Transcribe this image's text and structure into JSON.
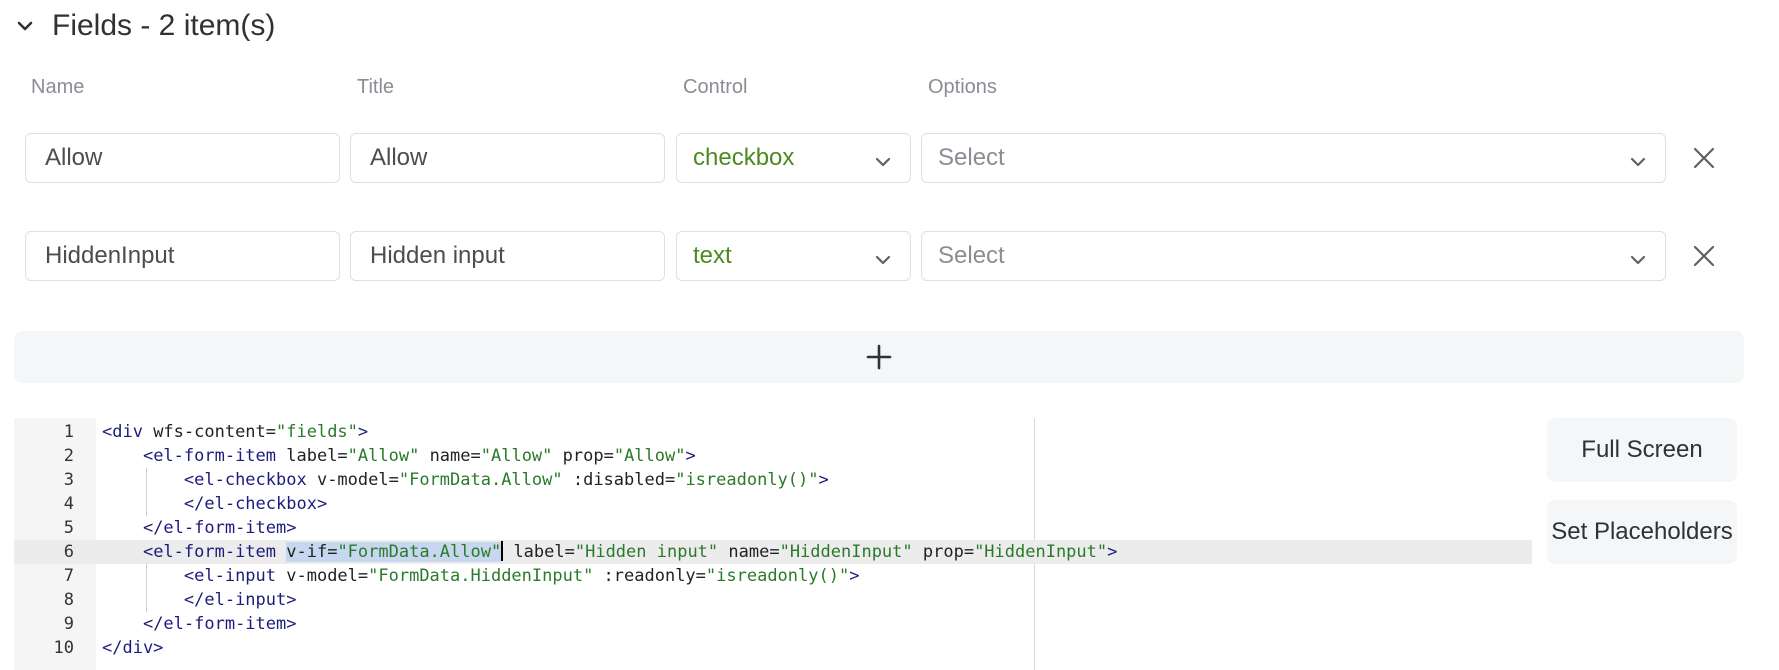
{
  "section": {
    "title": "Fields - 2 item(s)"
  },
  "columns": {
    "name": "Name",
    "title": "Title",
    "control": "Control",
    "options": "Options"
  },
  "rows": [
    {
      "name": "Allow",
      "title": "Allow",
      "control": "checkbox",
      "options_placeholder": "Select"
    },
    {
      "name": "HiddenInput",
      "title": "Hidden input",
      "control": "text",
      "options_placeholder": "Select"
    }
  ],
  "code_lines": [
    {
      "n": "1",
      "indent": "",
      "parts": [
        [
          "t",
          "<div "
        ],
        [
          "a",
          "wfs-content="
        ],
        [
          "s",
          "\"fields\""
        ],
        [
          "t",
          ">"
        ]
      ]
    },
    {
      "n": "2",
      "indent": "    ",
      "parts": [
        [
          "t",
          "<el-form-item "
        ],
        [
          "a",
          "label="
        ],
        [
          "s",
          "\"Allow\""
        ],
        [
          "a",
          " name="
        ],
        [
          "s",
          "\"Allow\""
        ],
        [
          "a",
          " prop="
        ],
        [
          "s",
          "\"Allow\""
        ],
        [
          "t",
          ">"
        ]
      ]
    },
    {
      "n": "3",
      "indent": "        ",
      "parts": [
        [
          "t",
          "<el-checkbox "
        ],
        [
          "a",
          "v-model="
        ],
        [
          "s",
          "\"FormData.Allow\""
        ],
        [
          "a",
          " :disabled="
        ],
        [
          "s",
          "\"isreadonly()\""
        ],
        [
          "t",
          ">"
        ]
      ]
    },
    {
      "n": "4",
      "indent": "        ",
      "parts": [
        [
          "t",
          "</el-checkbox>"
        ]
      ]
    },
    {
      "n": "5",
      "indent": "    ",
      "parts": [
        [
          "t",
          "</el-form-item>"
        ]
      ]
    },
    {
      "n": "6",
      "indent": "    ",
      "parts": [
        [
          "t",
          "<el-form-item "
        ],
        [
          "ah",
          "v-if="
        ],
        [
          "sh",
          "\"FormData.Allow\""
        ],
        [
          "cursor",
          ""
        ],
        [
          "a",
          " label="
        ],
        [
          "s",
          "\"Hidden input\""
        ],
        [
          "a",
          " name="
        ],
        [
          "s",
          "\"HiddenInput\""
        ],
        [
          "a",
          " prop="
        ],
        [
          "s",
          "\"HiddenInput\""
        ],
        [
          "t",
          ">"
        ]
      ]
    },
    {
      "n": "7",
      "indent": "        ",
      "parts": [
        [
          "t",
          "<el-input "
        ],
        [
          "a",
          "v-model="
        ],
        [
          "s",
          "\"FormData.HiddenInput\""
        ],
        [
          "a",
          " :readonly="
        ],
        [
          "s",
          "\"isreadonly()\""
        ],
        [
          "t",
          ">"
        ]
      ]
    },
    {
      "n": "8",
      "indent": "        ",
      "parts": [
        [
          "t",
          "</el-input>"
        ]
      ]
    },
    {
      "n": "9",
      "indent": "    ",
      "parts": [
        [
          "t",
          "</el-form-item>"
        ]
      ]
    },
    {
      "n": "10",
      "indent": "",
      "parts": [
        [
          "t",
          "</div>"
        ]
      ]
    }
  ],
  "active_line": "6",
  "buttons": {
    "full_screen": "Full Screen",
    "set_placeholders": "Set Placeholders"
  },
  "icons": {
    "collapse": "chevron-down-icon",
    "dropdown": "chevron-down-icon",
    "delete": "close-icon",
    "add": "plus-icon"
  },
  "colors": {
    "control_value": "#4e8a1f",
    "placeholder": "#8a8d93",
    "border": "#dcdfe6",
    "panel_bg": "#f5f6f7"
  }
}
